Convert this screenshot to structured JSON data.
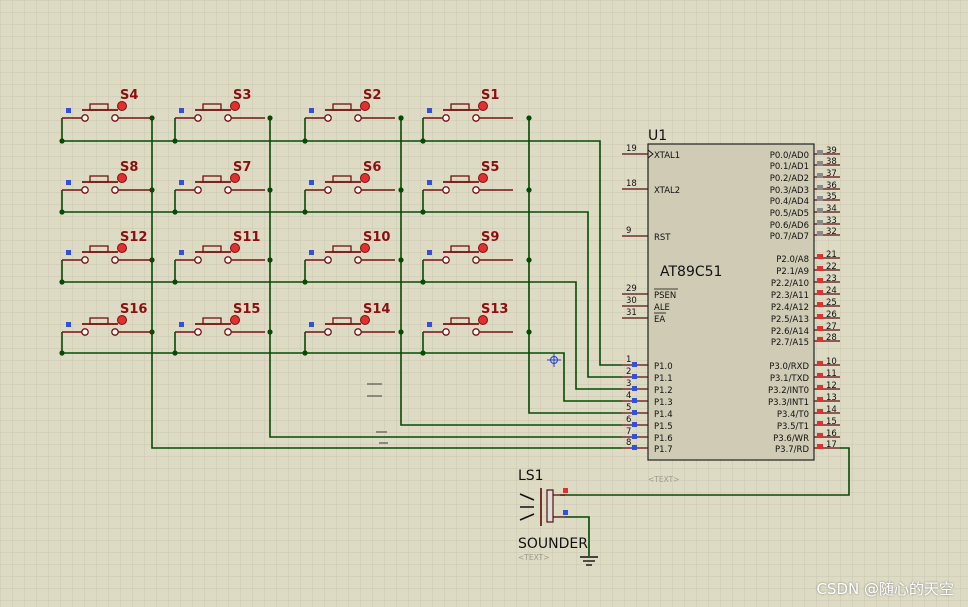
{
  "switches": [
    {
      "name": "S4"
    },
    {
      "name": "S3"
    },
    {
      "name": "S2"
    },
    {
      "name": "S1"
    },
    {
      "name": "S8"
    },
    {
      "name": "S7"
    },
    {
      "name": "S6"
    },
    {
      "name": "S5"
    },
    {
      "name": "S12"
    },
    {
      "name": "S11"
    },
    {
      "name": "S10"
    },
    {
      "name": "S9"
    },
    {
      "name": "S16"
    },
    {
      "name": "S15"
    },
    {
      "name": "S14"
    },
    {
      "name": "S13"
    }
  ],
  "chip": {
    "ref": "U1",
    "part": "AT89C51",
    "text_placeholder": "<TEXT>",
    "left_pins": [
      {
        "num": "19",
        "label": "XTAL1"
      },
      {
        "num": "18",
        "label": "XTAL2"
      },
      {
        "num": "9",
        "label": "RST"
      },
      {
        "num": "29",
        "label": "PSEN"
      },
      {
        "num": "30",
        "label": "ALE"
      },
      {
        "num": "31",
        "label": "EA"
      },
      {
        "num": "1",
        "label": "P1.0"
      },
      {
        "num": "2",
        "label": "P1.1"
      },
      {
        "num": "3",
        "label": "P1.2"
      },
      {
        "num": "4",
        "label": "P1.3"
      },
      {
        "num": "5",
        "label": "P1.4"
      },
      {
        "num": "6",
        "label": "P1.5"
      },
      {
        "num": "7",
        "label": "P1.6"
      },
      {
        "num": "8",
        "label": "P1.7"
      }
    ],
    "right_pins": [
      {
        "num": "39",
        "label": "P0.0/AD0"
      },
      {
        "num": "38",
        "label": "P0.1/AD1"
      },
      {
        "num": "37",
        "label": "P0.2/AD2"
      },
      {
        "num": "36",
        "label": "P0.3/AD3"
      },
      {
        "num": "35",
        "label": "P0.4/AD4"
      },
      {
        "num": "34",
        "label": "P0.5/AD5"
      },
      {
        "num": "33",
        "label": "P0.6/AD6"
      },
      {
        "num": "32",
        "label": "P0.7/AD7"
      },
      {
        "num": "21",
        "label": "P2.0/A8"
      },
      {
        "num": "22",
        "label": "P2.1/A9"
      },
      {
        "num": "23",
        "label": "P2.2/A10"
      },
      {
        "num": "24",
        "label": "P2.3/A11"
      },
      {
        "num": "25",
        "label": "P2.4/A12"
      },
      {
        "num": "26",
        "label": "P2.5/A13"
      },
      {
        "num": "27",
        "label": "P2.6/A14"
      },
      {
        "num": "28",
        "label": "P2.7/A15"
      },
      {
        "num": "10",
        "label": "P3.0/RXD"
      },
      {
        "num": "11",
        "label": "P3.1/TXD"
      },
      {
        "num": "12",
        "label": "P3.2/INT0"
      },
      {
        "num": "13",
        "label": "P3.3/INT1"
      },
      {
        "num": "14",
        "label": "P3.4/T0"
      },
      {
        "num": "15",
        "label": "P3.5/T1"
      },
      {
        "num": "16",
        "label": "P3.6/WR"
      },
      {
        "num": "17",
        "label": "P3.7/RD"
      }
    ]
  },
  "buzzer": {
    "ref": "LS1",
    "part": "SOUNDER",
    "text_placeholder": "<TEXT>"
  },
  "watermark": "CSDN @随心的天空",
  "colors": {
    "background": "#dedbc4",
    "grid": "#c9c6ae",
    "wire": "#064a06",
    "component": "#7a1010",
    "label": "#8b0f0f",
    "chip_fill": "#cfcbb4",
    "pin_marker_gray": "#8a8a8a",
    "pin_marker_red": "#e03030",
    "pin_marker_blue": "#3050e0"
  }
}
